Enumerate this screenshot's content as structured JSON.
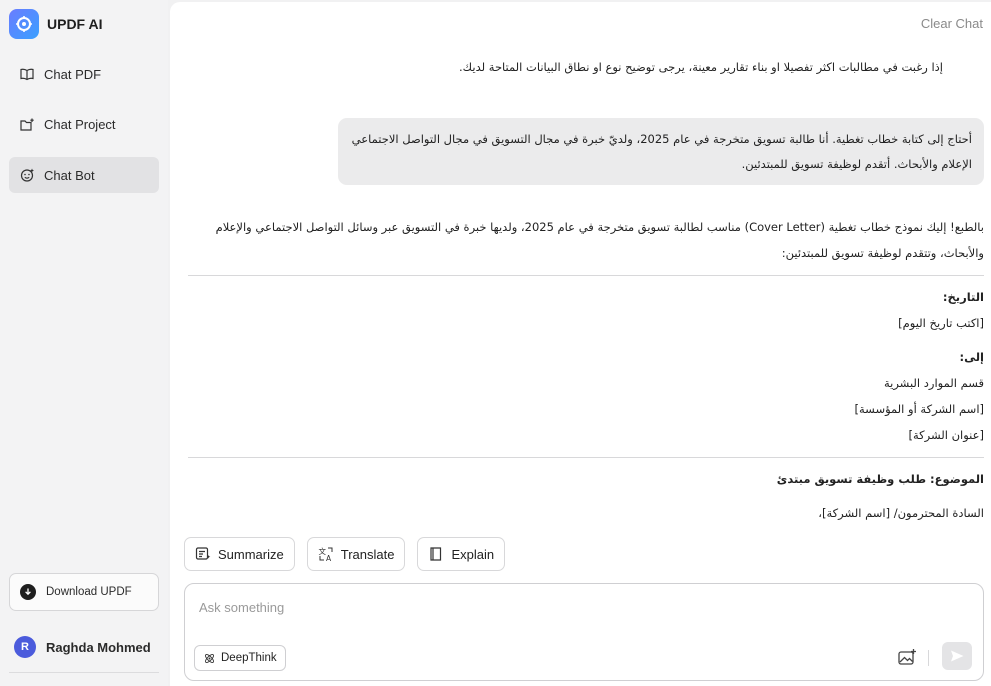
{
  "app": {
    "name": "UPDF AI"
  },
  "sidebar": {
    "items": [
      {
        "label": "Chat PDF",
        "icon": "book-open-icon",
        "active": false
      },
      {
        "label": "Chat Project",
        "icon": "folder-plus-icon",
        "active": false
      },
      {
        "label": "Chat Bot",
        "icon": "bot-face-icon",
        "active": true
      }
    ],
    "download_label": "Download UPDF",
    "user": {
      "initial": "R",
      "name": "Raghda Mohmed"
    }
  },
  "header": {
    "clear_chat": "Clear Chat"
  },
  "chat": {
    "prev_ai_message": "إذا رغبت في مطالبات اكثر تفصيلا او بناء تقارير معينة، يرجى توضيح نوع او نطاق البيانات المتاحة لديك.",
    "user_message": {
      "line1": "أحتاج إلى كتابة خطاب تغطية. أنا طالبة تسويق متخرجة في عام 2025، ولديّ خبرة في مجال التسويق في مجال التواصل الاجتماعي",
      "line2": "الإعلام والأبحاث. أتقدم لوظيفة تسويق للمبتدئين."
    },
    "response": {
      "intro_line1": "بالطبع! إليك نموذج خطاب تغطية (Cover Letter) مناسب لطالبة تسويق متخرجة في عام 2025، ولديها خبرة في التسويق عبر وسائل التواصل الاجتماعي والإعلام",
      "intro_line2": "والأبحاث، وتتقدم لوظيفة تسويق للمبتدئين:",
      "date_label": "التاريخ:",
      "date_value": "[اكتب تاريخ اليوم]",
      "to_label": "إلى:",
      "to_line1": "قسم الموارد البشرية",
      "to_line2": "[اسم الشركة أو المؤسسة]",
      "to_line3": "[عنوان الشركة]",
      "subject": "الموضوع: طلب وظيفة تسويق مبتدئ",
      "greeting": "السادة المحترمون/ [اسم الشركة]،"
    }
  },
  "actions": [
    {
      "label": "Summarize",
      "icon": "summarize-icon"
    },
    {
      "label": "Translate",
      "icon": "translate-icon"
    },
    {
      "label": "Explain",
      "icon": "book-icon"
    }
  ],
  "input": {
    "placeholder": "Ask something",
    "value": "",
    "deepthink_label": "DeepThink"
  },
  "colors": {
    "brand": "#4b5bdc",
    "active_nav": "#e2e2e4",
    "bubble": "#ebebec"
  }
}
